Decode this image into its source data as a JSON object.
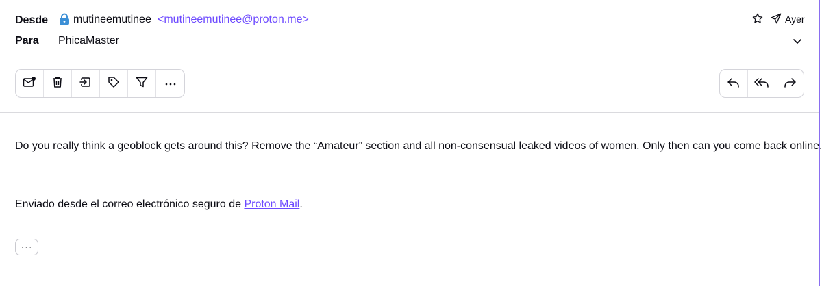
{
  "header": {
    "from_label": "Desde",
    "sender_name": "mutineemutinee",
    "sender_address": "<mutineemutinee@proton.me>",
    "to_label": "Para",
    "recipient": "PhicaMaster",
    "date": "Ayer",
    "icons": [
      "lock-icon",
      "star-icon",
      "send-icon",
      "chevron-down-icon"
    ]
  },
  "toolbar": {
    "left_actions": [
      "mark-unread-icon",
      "trash-icon",
      "move-to-folder-icon",
      "label-icon",
      "filter-icon",
      "more-options-icon"
    ],
    "right_actions": [
      "reply-icon",
      "reply-all-icon",
      "forward-icon"
    ]
  },
  "message": {
    "body": "Do you really think a geoblock gets around this? Remove the “Amateur” section and all non-consensual leaked videos of women. Only then can you come back online.",
    "signature_prefix": "Enviado desde el correo electrónico seguro de ",
    "signature_link": "Proton Mail",
    "signature_suffix": ".",
    "expand_button": "···"
  },
  "colors": {
    "accent": "#6d4aff",
    "lock": "#3b8fd6",
    "text": "#0c0c14",
    "border": "#d4d4da"
  }
}
